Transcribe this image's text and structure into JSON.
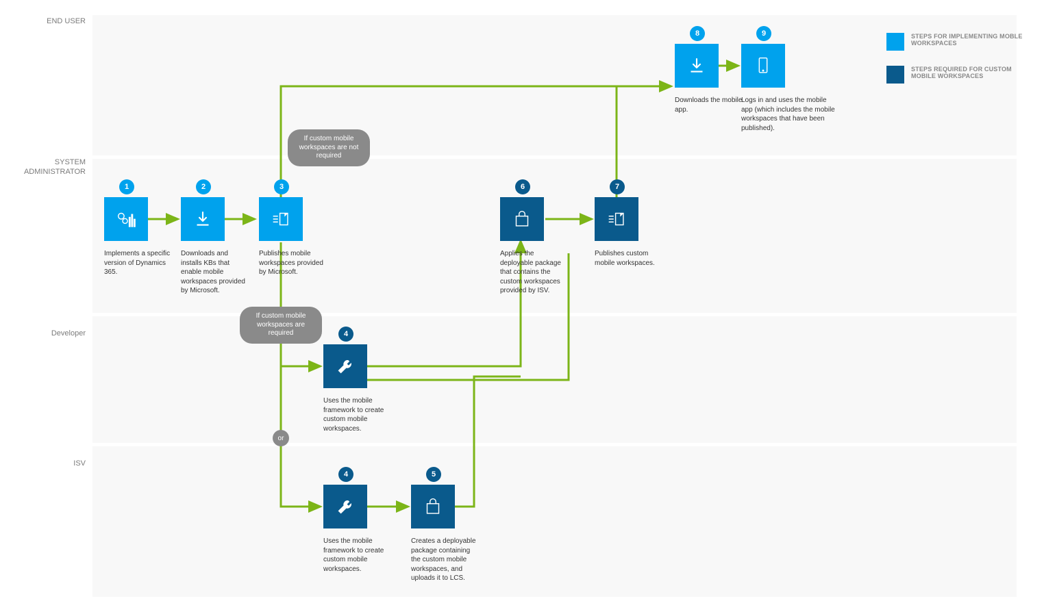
{
  "lanes": {
    "end_user": "END USER",
    "sysadmin": "SYSTEM ADMINISTRATOR",
    "developer": "Developer",
    "isv": "ISV"
  },
  "legend": {
    "impl": "STEPS FOR IMPLEMENTING MOBLE WORKSPACES",
    "custom": "STEPS REQUIRED FOR CUSTOM MOBILE WORKSPACES"
  },
  "bubbles": {
    "not_required": "If custom mobile workspaces are not required",
    "required": "If custom mobile workspaces are required",
    "or": "or"
  },
  "steps": {
    "s1": {
      "num": "1",
      "cap": "Implements a specific version of Dynamics 365."
    },
    "s2": {
      "num": "2",
      "cap": "Downloads and installs KBs that enable mobile workspaces provided by Microsoft."
    },
    "s3": {
      "num": "3",
      "cap": "Publishes mobile workspaces provided by Microsoft."
    },
    "s4a": {
      "num": "4",
      "cap": "Uses the mobile framework to create custom mobile workspaces."
    },
    "s4b": {
      "num": "4",
      "cap": "Uses the mobile framework to create custom mobile workspaces."
    },
    "s5": {
      "num": "5",
      "cap": "Creates a deployable package containing the custom mobile workspaces, and uploads it to LCS."
    },
    "s6": {
      "num": "6",
      "cap": "Applies the deployable package that contains the custom workspaces provided by ISV."
    },
    "s7": {
      "num": "7",
      "cap": "Publishes custom mobile workspaces."
    },
    "s8": {
      "num": "8",
      "cap": "Downloads the mobile app."
    },
    "s9": {
      "num": "9",
      "cap": "Logs in and uses the mobile app (which includes the mobile workspaces that have been published)."
    }
  }
}
